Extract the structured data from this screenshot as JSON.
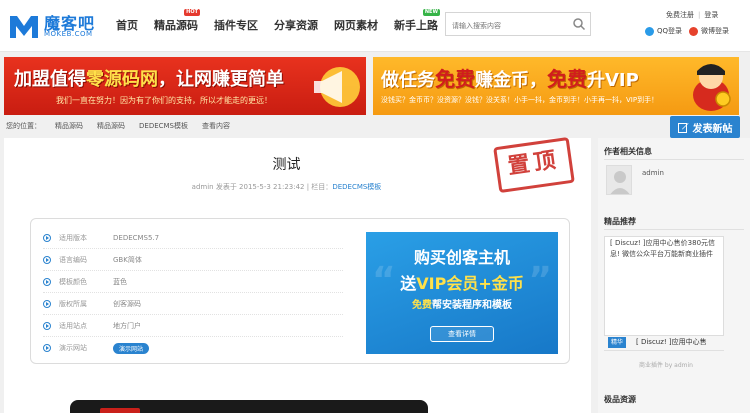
{
  "header": {
    "logo_cn": "魔客吧",
    "logo_en": "MOKEB.COM",
    "nav": [
      {
        "label": "首页",
        "badge": ""
      },
      {
        "label": "精品源码",
        "badge": "HOT"
      },
      {
        "label": "插件专区",
        "badge": ""
      },
      {
        "label": "分享资源",
        "badge": ""
      },
      {
        "label": "网页素材",
        "badge": ""
      },
      {
        "label": "新手上路",
        "badge": "NEW"
      }
    ],
    "search_placeholder": "请输入搜索内容",
    "register": "免费注册",
    "login": "登录",
    "qq_login": "QQ登录",
    "weibo_login": "微博登录"
  },
  "banners": {
    "left_title_a": "加盟值得",
    "left_title_hl": "零源码网",
    "left_title_b": "，让网赚更简单",
    "left_sub": "我们一直在努力！因为有了你们的支持，所以才能走的更远！",
    "right_title_a": "做任务",
    "right_title_big": "免费",
    "right_title_b": "赚金币，",
    "right_title_c": "免费",
    "right_title_d": "升VIP",
    "right_sub": "没钱买？金币币？没资源？没钱？没关系！小手一抖，金币到手！小手再一抖，VIP到手！"
  },
  "breadcrumb": {
    "location": "您的位置：",
    "items": [
      "精品源码",
      "精品源码",
      "DEDECMS模板",
      "查看内容"
    ]
  },
  "post_button": "发表新帖",
  "article": {
    "title": "测试",
    "meta_prefix": "admin 发表于 2015-5-3 21:23:42  |  栏目：",
    "category": "DEDECMS模板",
    "stamp": "置顶",
    "info": [
      {
        "label": "适用版本",
        "value": "DEDECMS5.7"
      },
      {
        "label": "语言编码",
        "value": "GBK简体"
      },
      {
        "label": "模板颜色",
        "value": "蓝色"
      },
      {
        "label": "版权所属",
        "value": "创客源码"
      },
      {
        "label": "适用站点",
        "value": "地方门户"
      },
      {
        "label": "演示网站",
        "value": "演示网站"
      }
    ],
    "ad": {
      "line1": "购买创客主机",
      "line2_a": "送",
      "line2_b": "VIP会员+金币",
      "line3_a": "免费",
      "line3_b": "帮安装程序和模板",
      "button": "查看详情"
    }
  },
  "sidebar": {
    "author_title": "作者相关信息",
    "author_name": "admin",
    "recommend_title": "精品推荐",
    "recommend_text": "[ Discuz! ]应用中心售价380元信息! 微信公众平台万能新商业插件",
    "recommend_tag": "精华",
    "recommend_name": "[ Discuz! ]应用中心售",
    "recommend_by": "商业插件 by admin",
    "resources_title": "极品资源"
  }
}
